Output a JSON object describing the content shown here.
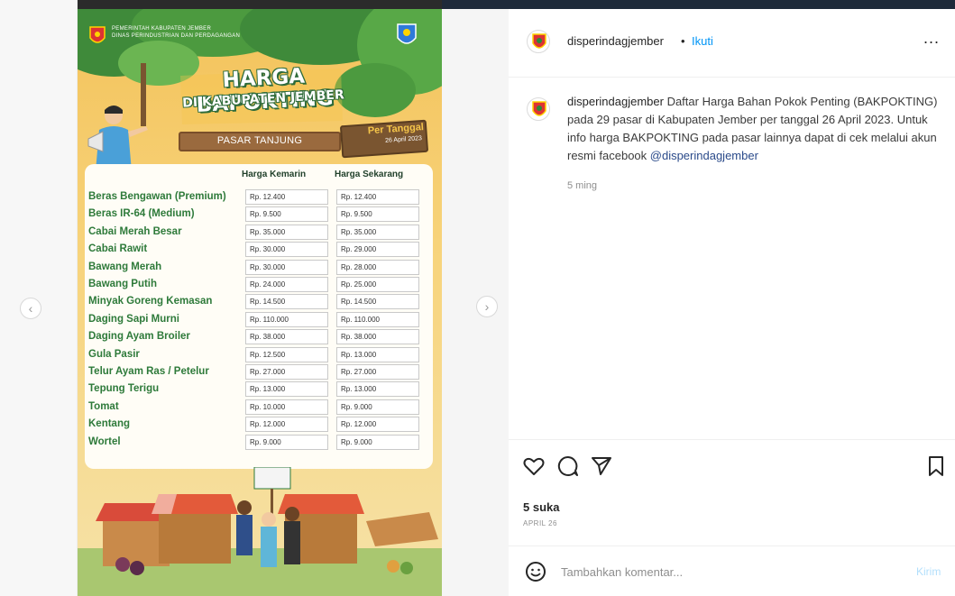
{
  "header": {
    "username": "disperindagjember",
    "separator": "•",
    "follow_label": "Ikuti",
    "more_label": "..."
  },
  "caption": {
    "username": "disperindagjember",
    "text": " Daftar Harga Bahan Pokok Penting (BAKPOKTING) pada 29 pasar di Kabupaten Jember per tanggal 26 April 2023. Untuk info harga BAKPOKTING pada pasar lainnya dapat di cek melalui akun resmi facebook ",
    "mention": "@disperindagjember",
    "time_ago": "5 ming"
  },
  "actions": {
    "like_icon": "heart-icon",
    "comment_icon": "comment-icon",
    "share_icon": "share-icon",
    "save_icon": "bookmark-icon"
  },
  "likes": "5 suka",
  "post_date": "APRIL 26",
  "comment": {
    "placeholder": "Tambahkan komentar...",
    "post_label": "Kirim"
  },
  "poster": {
    "gov_line1": "PEMERINTAH KABUPATEN JEMBER",
    "gov_line2": "DINAS PERINDUSTRIAN DAN PERDAGANGAN",
    "title": "HARGA BAPOKTING",
    "subtitle": "DI KABUPATEN JEMBER",
    "market": "PASAR TANJUNG",
    "date_title": "Per Tanggal",
    "date_value": "26 April 2023",
    "col_kemarin": "Harga Kemarin",
    "col_sekarang": "Harga Sekarang",
    "items": [
      {
        "name": "Beras Bengawan (Premium)",
        "kemarin": "Rp. 12.400",
        "sekarang": "Rp. 12.400"
      },
      {
        "name": "Beras IR-64 (Medium)",
        "kemarin": "Rp. 9.500",
        "sekarang": "Rp. 9.500"
      },
      {
        "name": "Cabai Merah Besar",
        "kemarin": "Rp. 35.000",
        "sekarang": "Rp. 35.000"
      },
      {
        "name": "Cabai Rawit",
        "kemarin": "Rp. 30.000",
        "sekarang": "Rp. 29.000"
      },
      {
        "name": "Bawang Merah",
        "kemarin": "Rp. 30.000",
        "sekarang": "Rp. 28.000"
      },
      {
        "name": "Bawang Putih",
        "kemarin": "Rp. 24.000",
        "sekarang": "Rp. 25.000"
      },
      {
        "name": "Minyak Goreng Kemasan",
        "kemarin": "Rp. 14.500",
        "sekarang": "Rp. 14.500"
      },
      {
        "name": "Daging Sapi Murni",
        "kemarin": "Rp. 110.000",
        "sekarang": "Rp. 110.000"
      },
      {
        "name": "Daging Ayam Broiler",
        "kemarin": "Rp. 38.000",
        "sekarang": "Rp. 38.000"
      },
      {
        "name": "Gula Pasir",
        "kemarin": "Rp. 12.500",
        "sekarang": "Rp. 13.000"
      },
      {
        "name": "Telur Ayam Ras / Petelur",
        "kemarin": "Rp. 27.000",
        "sekarang": "Rp. 27.000"
      },
      {
        "name": "Tepung Terigu",
        "kemarin": "Rp. 13.000",
        "sekarang": "Rp. 13.000"
      },
      {
        "name": "Tomat",
        "kemarin": "Rp. 10.000",
        "sekarang": "Rp. 9.000"
      },
      {
        "name": "Kentang",
        "kemarin": "Rp. 12.000",
        "sekarang": "Rp. 12.000"
      },
      {
        "name": "Wortel",
        "kemarin": "Rp. 9.000",
        "sekarang": "Rp. 9.000"
      }
    ]
  },
  "nav": {
    "prev_icon": "chevron-left-icon",
    "next_icon": "chevron-right-icon",
    "prev_glyph": "‹",
    "next_glyph": "›"
  },
  "colors": {
    "follow": "#0095f6",
    "item_green": "#2e7a3a",
    "poster_bg": "#f3c25a"
  }
}
